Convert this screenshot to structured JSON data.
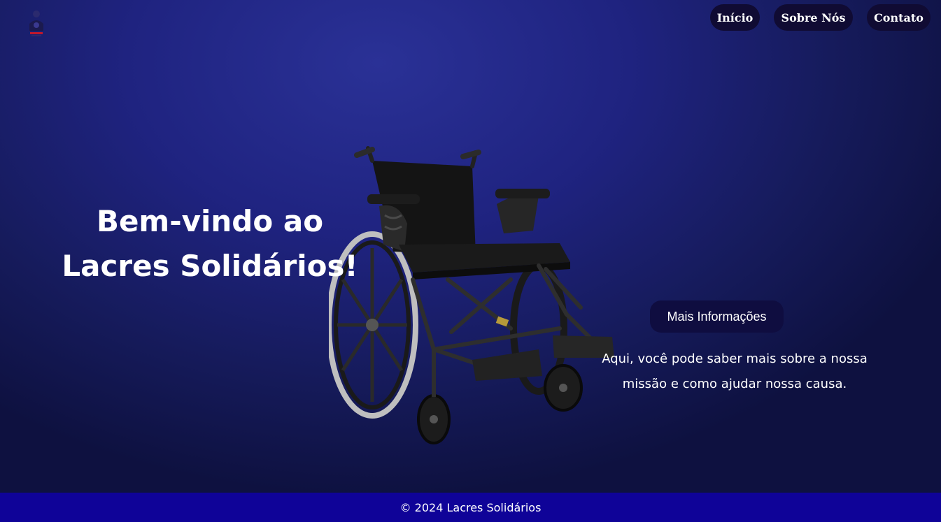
{
  "nav": {
    "items": [
      {
        "label": "Início"
      },
      {
        "label": "Sobre Nós"
      },
      {
        "label": "Contato"
      }
    ]
  },
  "hero": {
    "title_line1": "Bem-vindo ao",
    "title_line2": "Lacres Solidários!"
  },
  "info": {
    "button_label": "Mais Informações",
    "text_line1": "Aqui, você pode saber mais sobre a nossa",
    "text_line2": "missão e como ajudar nossa causa."
  },
  "footer": {
    "copyright": "© 2024 Lacres Solidários"
  },
  "colors": {
    "nav_button_bg": "#100b33",
    "footer_bg": "#0f0398",
    "more_button_bg": "#0f0d40",
    "background_center": "#2a3196",
    "background_edge": "#0e1140"
  },
  "icons": {
    "logo": "logo-icon",
    "hero_image": "wheelchair-image"
  }
}
